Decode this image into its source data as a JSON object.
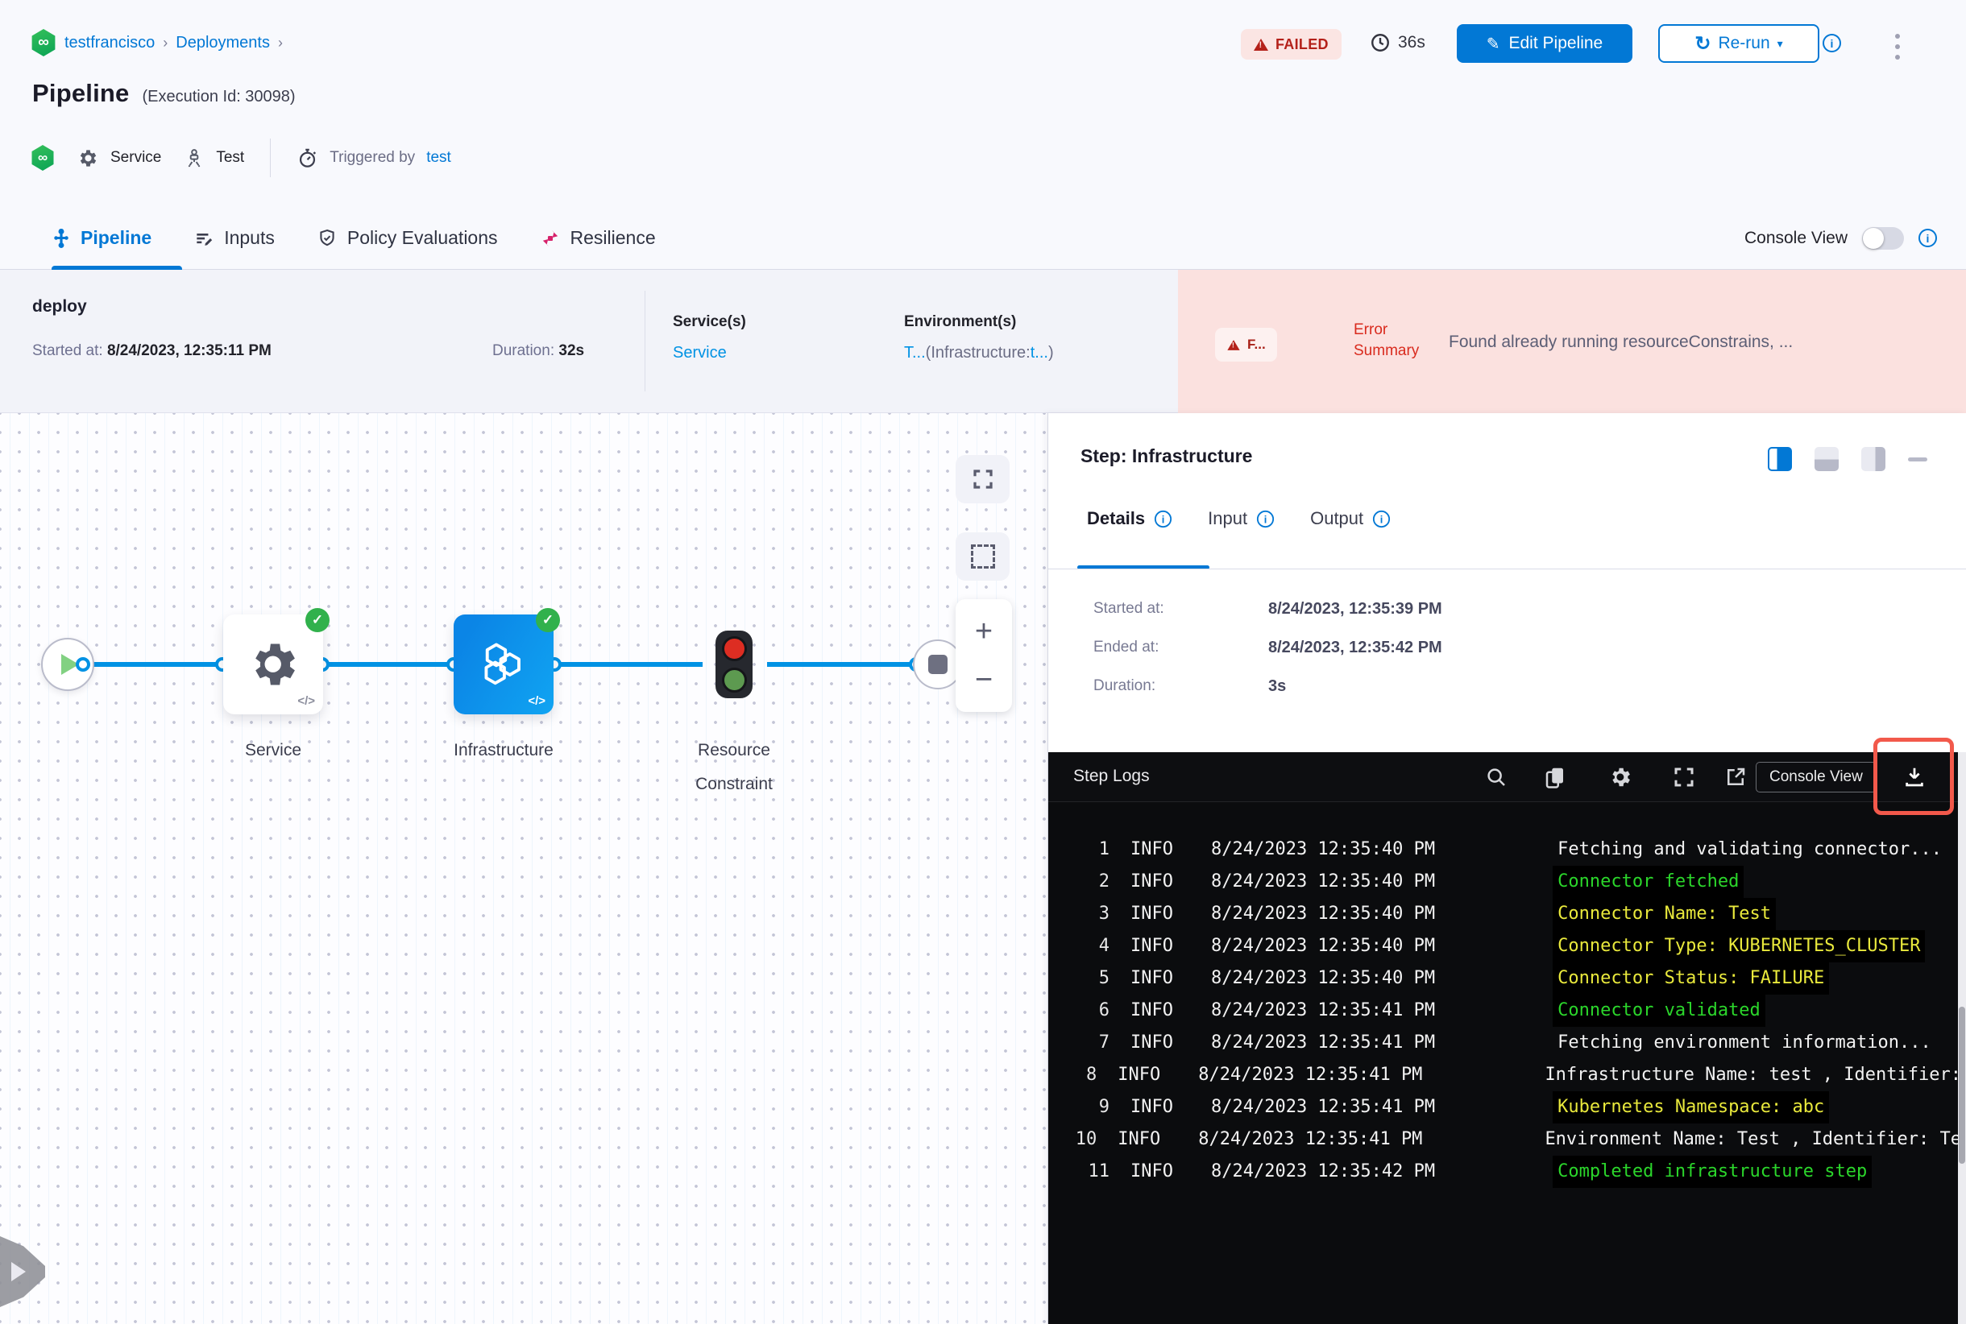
{
  "header": {
    "breadcrumb": {
      "items": [
        "testfrancisco",
        "Deployments"
      ],
      "separator": "›"
    },
    "title": "Pipeline",
    "execution_id": "(Execution Id: 30098)",
    "status_badge": "FAILED",
    "elapsed": "36s",
    "edit_pipeline_label": "Edit Pipeline",
    "rerun_label": "Re-run",
    "meta": {
      "service_label": "Service",
      "environment_label": "Test",
      "triggered_by_label": "Triggered by",
      "triggered_by_user": "test"
    }
  },
  "tab_bar": {
    "tabs": [
      {
        "label": "Pipeline"
      },
      {
        "label": "Inputs"
      },
      {
        "label": "Policy Evaluations"
      },
      {
        "label": "Resilience"
      }
    ],
    "console_view_label": "Console View"
  },
  "summary": {
    "stage_name": "deploy",
    "started_label": "Started at:",
    "started_value": "8/24/2023, 12:35:11 PM",
    "duration_label": "Duration:",
    "duration_value": "32s",
    "services_label": "Service(s)",
    "services_value": "Service",
    "environments_label": "Environment(s)",
    "environments_value_link": "T...",
    "environments_value_infra": "(Infrastructure:",
    "environments_value_infra_link": "t...",
    "environments_value_close": ")",
    "error_badge": "F...",
    "error_label_line1": "Error",
    "error_label_line2": "Summary",
    "error_message": "Found already running resourceConstrains, ..."
  },
  "canvas": {
    "nodes": {
      "service": {
        "label": "Service"
      },
      "infrastructure": {
        "label": "Infrastructure"
      },
      "resource_constraint": {
        "label_line1": "Resource",
        "label_line2": "Constraint"
      }
    },
    "zoom_plus": "+",
    "zoom_minus": "−"
  },
  "step_panel": {
    "title": "Step: Infrastructure",
    "tabs": [
      {
        "label": "Details"
      },
      {
        "label": "Input"
      },
      {
        "label": "Output"
      }
    ],
    "details": {
      "rows": [
        {
          "label": "Started at:",
          "value": "8/24/2023, 12:35:39 PM"
        },
        {
          "label": "Ended at:",
          "value": "8/24/2023, 12:35:42 PM"
        },
        {
          "label": "Duration:",
          "value": "3s"
        }
      ]
    }
  },
  "step_logs": {
    "title": "Step Logs",
    "console_view_label": "Console View",
    "rows": [
      {
        "num": "1",
        "level": "INFO",
        "time": "8/24/2023 12:35:40 PM",
        "message": "Fetching and validating connector...",
        "color": "white"
      },
      {
        "num": "2",
        "level": "INFO",
        "time": "8/24/2023 12:35:40 PM",
        "message": "Connector fetched",
        "color": "green"
      },
      {
        "num": "3",
        "level": "INFO",
        "time": "8/24/2023 12:35:40 PM",
        "message": "Connector Name: Test",
        "color": "yellow"
      },
      {
        "num": "4",
        "level": "INFO",
        "time": "8/24/2023 12:35:40 PM",
        "message": "Connector Type: KUBERNETES_CLUSTER",
        "color": "yellow"
      },
      {
        "num": "5",
        "level": "INFO",
        "time": "8/24/2023 12:35:40 PM",
        "message": "Connector Status: FAILURE",
        "color": "yellow"
      },
      {
        "num": "6",
        "level": "INFO",
        "time": "8/24/2023 12:35:41 PM",
        "message": "Connector validated",
        "color": "green"
      },
      {
        "num": "7",
        "level": "INFO",
        "time": "8/24/2023 12:35:41 PM",
        "message": "Fetching environment information...",
        "color": "white"
      },
      {
        "num": "8",
        "level": "INFO",
        "time": "8/24/2023 12:35:41 PM",
        "message": "Infrastructure Name: test , Identifier:",
        "color": "white"
      },
      {
        "num": "9",
        "level": "INFO",
        "time": "8/24/2023 12:35:41 PM",
        "message": "Kubernetes Namespace: abc",
        "color": "yellow"
      },
      {
        "num": "10",
        "level": "INFO",
        "time": "8/24/2023 12:35:41 PM",
        "message": "Environment Name: Test , Identifier: Te",
        "color": "white"
      },
      {
        "num": "11",
        "level": "INFO",
        "time": "8/24/2023 12:35:42 PM",
        "message": "Completed infrastructure step",
        "color": "green"
      }
    ]
  },
  "colors": {
    "primary_blue": "#0278d5",
    "link_blue": "#0092e4",
    "failed_red": "#b4211a",
    "error_bg": "#fbe1df",
    "node_blue": "#0b85e6",
    "success_green": "#31b14c",
    "log_green": "#2bd62b",
    "log_yellow": "#e9e93c",
    "annotation_red": "#f2594b"
  }
}
